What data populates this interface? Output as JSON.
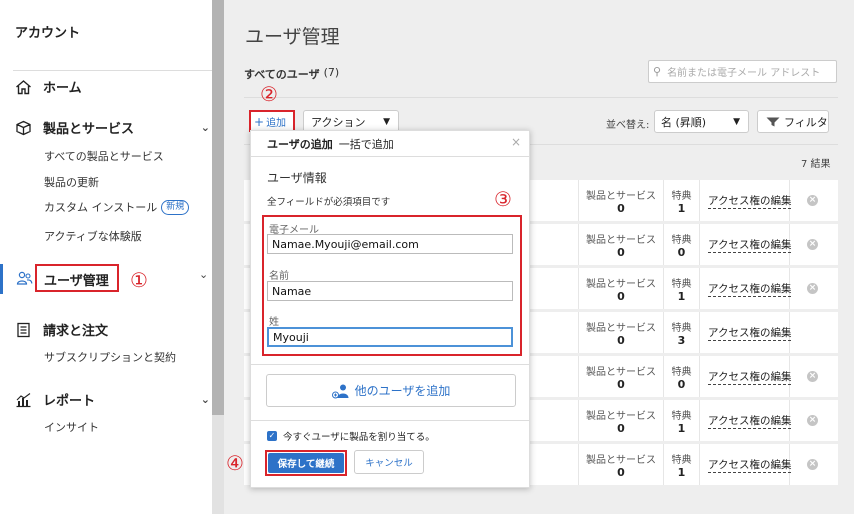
{
  "sidebar": {
    "title": "アカウント",
    "home": "ホーム",
    "products": "製品とサービス",
    "products_sub": [
      "すべての製品とサービス",
      "製品の更新",
      "カスタム インストール",
      "アクティブな体験版"
    ],
    "new_badge": "新規",
    "users": "ユーザ管理",
    "billing": "請求と注文",
    "billing_sub": [
      "サブスクリプションと契約"
    ],
    "reports": "レポート",
    "reports_sub": [
      "インサイト"
    ]
  },
  "annotations": {
    "n1": "①",
    "n2": "②",
    "n3": "③",
    "n4": "④"
  },
  "main": {
    "title": "ユーザ管理",
    "all_users": "すべてのユーザ",
    "count": "(7)",
    "search_placeholder": "名前または電子メール アドレスト",
    "add": "追加",
    "actions": "アクション",
    "sort_label": "並べ替え:",
    "sort_value": "名 (昇順)",
    "filter": "フィルタ",
    "results": "7 結果",
    "col_products": "製品とサービス",
    "col_perks": "特典",
    "edit_access": "アクセス権の編集",
    "rows": [
      {
        "products": "0",
        "perks": "1",
        "edit": true,
        "remove": true
      },
      {
        "products": "0",
        "perks": "0",
        "edit": true,
        "remove": true
      },
      {
        "products": "0",
        "perks": "1",
        "edit": true,
        "remove": true
      },
      {
        "products": "0",
        "perks": "3",
        "edit": true,
        "remove": false
      },
      {
        "products": "0",
        "perks": "0",
        "edit": true,
        "remove": true
      },
      {
        "products": "0",
        "perks": "1",
        "edit": true,
        "remove": true
      },
      {
        "products": "0",
        "perks": "1",
        "edit": true,
        "remove": true
      }
    ]
  },
  "panel": {
    "tab_add": "ユーザの追加",
    "tab_bulk": "一括で追加",
    "close": "×",
    "section": "ユーザ情報",
    "required": "全フィールドが必須項目です",
    "email_label": "電子メール",
    "email_value": "Namae.Myouji@email.com",
    "first_label": "名前",
    "first_value": "Namae",
    "last_label": "姓",
    "last_value": "Myouji",
    "add_other": "他のユーザを追加",
    "assign_now": "今すぐユーザに製品を割り当てる。",
    "save": "保存して継続",
    "cancel": "キャンセル"
  }
}
